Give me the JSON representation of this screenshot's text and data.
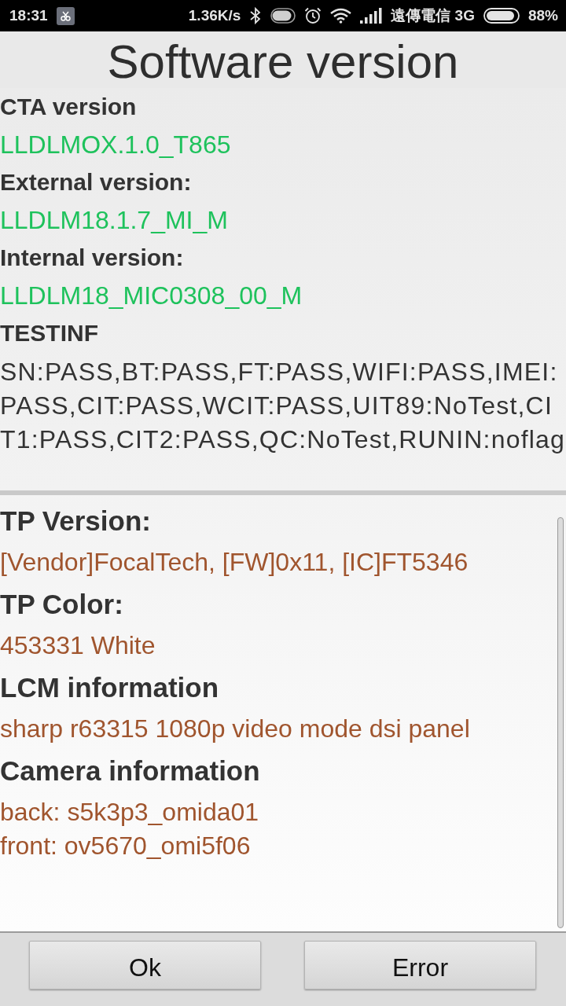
{
  "status_bar": {
    "time": "18:31",
    "speed": "1.36K/s",
    "carrier": "遠傳電信 3G",
    "battery": "88%"
  },
  "title": "Software version",
  "software_info": [
    {
      "kind": "version",
      "label": "CTA version",
      "value": "LLDLMOX.1.0_T865"
    },
    {
      "kind": "version",
      "label": "External version:",
      "value": "LLDLM18.1.7_MI_M"
    },
    {
      "kind": "version",
      "label": "Internal version:",
      "value": "LLDLM18_MIC0308_00_M"
    },
    {
      "kind": "report",
      "label": "TESTINF",
      "value": "SN:PASS,BT:PASS,FT:PASS,WIFI:PASS,IMEI:PASS,CIT:PASS,WCIT:PASS,UIT89:NoTest,CIT1:PASS,CIT2:PASS,QC:NoTest,RUNIN:noflag"
    }
  ],
  "hardware_info": [
    {
      "label": "TP Version:",
      "values": [
        "[Vendor]FocalTech, [FW]0x11, [IC]FT5346"
      ]
    },
    {
      "label": "TP Color:",
      "values": [
        "453331 White"
      ]
    },
    {
      "label": "LCM information",
      "values": [
        "sharp r63315 1080p video mode dsi panel"
      ]
    },
    {
      "label": "Camera information",
      "values": [
        "back: s5k3p3_omida01",
        "front: ov5670_omi5f06"
      ]
    }
  ],
  "buttons": [
    {
      "label": "Ok"
    },
    {
      "label": "Error"
    }
  ]
}
